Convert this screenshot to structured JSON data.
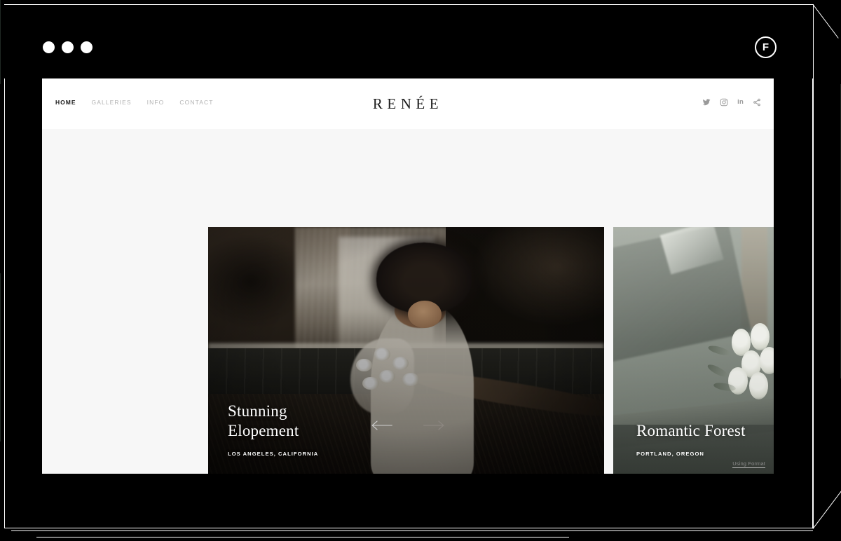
{
  "mockup": {
    "window_dots": [
      "dot-1",
      "dot-2",
      "dot-3"
    ],
    "brand_badge": "F",
    "frame_color": "#ffffff",
    "background_color": "#000000"
  },
  "site": {
    "logo": "RENÉE",
    "nav": [
      {
        "label": "HOME",
        "active": true
      },
      {
        "label": "GALLERIES",
        "active": false
      },
      {
        "label": "INFO",
        "active": false
      },
      {
        "label": "CONTACT",
        "active": false
      }
    ],
    "socials": [
      {
        "name": "twitter-icon",
        "label": "Twitter"
      },
      {
        "name": "instagram-icon",
        "label": "Instagram"
      },
      {
        "name": "linkedin-icon",
        "label": "in"
      },
      {
        "name": "share-icon",
        "label": "Share"
      }
    ],
    "header_background": "#ffffff",
    "page_background": "#f7f7f7"
  },
  "gallery": {
    "cards": [
      {
        "title": "Stunning\nElopement",
        "location": "LOS ANGELES, CALIFORNIA",
        "image_alt": "Bride with afro holding dried bouquet by a dark waterfall pool"
      },
      {
        "title": "Romantic Forest",
        "location": "PORTLAND, OREGON",
        "image_alt": "Hazy grey-green scene with white bouquet on a stone ledge"
      }
    ],
    "prev_label": "Previous",
    "next_label": "Next",
    "prev_state": "disabled",
    "next_state": "active"
  },
  "footer": {
    "using_format": "Using Format"
  }
}
